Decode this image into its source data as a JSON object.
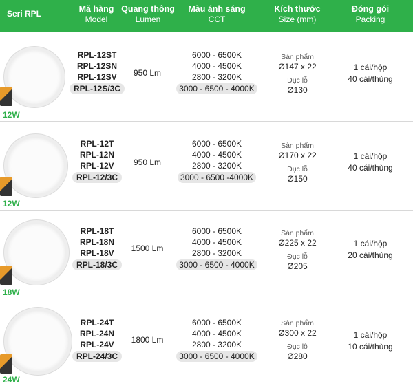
{
  "header": {
    "series": "Seri RPL",
    "model_vi": "Mã hàng",
    "model_en": "Model",
    "lumen_vi": "Quang thông",
    "lumen_en": "Lumen",
    "cct_vi": "Màu ánh sáng",
    "cct_en": "CCT",
    "size_vi": "Kích thước",
    "size_en": "Size (mm)",
    "pack_vi": "Đóng gói",
    "pack_en": "Packing"
  },
  "rows": [
    {
      "watt": "12W",
      "models": [
        "RPL-12ST",
        "RPL-12SN",
        "RPL-12SV"
      ],
      "model_combo": "RPL-12S/3C",
      "lumen": "950 Lm",
      "cct": [
        "6000 - 6500K",
        "4000 - 4500K",
        "2800 - 3200K"
      ],
      "cct_combo": "3000 - 6500 - 4000K",
      "product_label": "Sản phẩm",
      "product_size": "Ø147 x 22",
      "cut_label": "Đục lỗ",
      "cut_size": "Ø130",
      "pack1": "1 cái/hộp",
      "pack2": "40 cái/thùng"
    },
    {
      "watt": "12W",
      "models": [
        "RPL-12T",
        "RPL-12N",
        "RPL-12V"
      ],
      "model_combo": "RPL-12/3C",
      "lumen": "950 Lm",
      "cct": [
        "6000 - 6500K",
        "4000 - 4500K",
        "2800 - 3200K"
      ],
      "cct_combo": "3000 - 6500 -4000K",
      "product_label": "Sản phẩm",
      "product_size": "Ø170 x 22",
      "cut_label": "Đục lỗ",
      "cut_size": "Ø150",
      "pack1": "1 cái/hộp",
      "pack2": "40 cái/thùng"
    },
    {
      "watt": "18W",
      "models": [
        "RPL-18T",
        "RPL-18N",
        "RPL-18V"
      ],
      "model_combo": "RPL-18/3C",
      "lumen": "1500 Lm",
      "cct": [
        "6000 - 6500K",
        "4000 - 4500K",
        "2800 - 3200K"
      ],
      "cct_combo": "3000 - 6500 - 4000K",
      "product_label": "Sản phẩm",
      "product_size": "Ø225 x 22",
      "cut_label": "Đục lỗ",
      "cut_size": "Ø205",
      "pack1": "1 cái/hộp",
      "pack2": "20 cái/thùng"
    },
    {
      "watt": "24W",
      "models": [
        "RPL-24T",
        "RPL-24N",
        "RPL-24V"
      ],
      "model_combo": "RPL-24/3C",
      "lumen": "1800 Lm",
      "cct": [
        "6000 - 6500K",
        "4000 - 4500K",
        "2800 - 3200K"
      ],
      "cct_combo": "3000 - 6500 - 4000K",
      "product_label": "Sản phẩm",
      "product_size": "Ø300 x 22",
      "cut_label": "Đục lỗ",
      "cut_size": "Ø280",
      "pack1": "1 cái/hộp",
      "pack2": "10 cái/thùng"
    }
  ],
  "colors": {
    "header_bg": "#2fb04a",
    "watt_text": "#2fb04a",
    "pill_bg": "#e6e6e6"
  }
}
